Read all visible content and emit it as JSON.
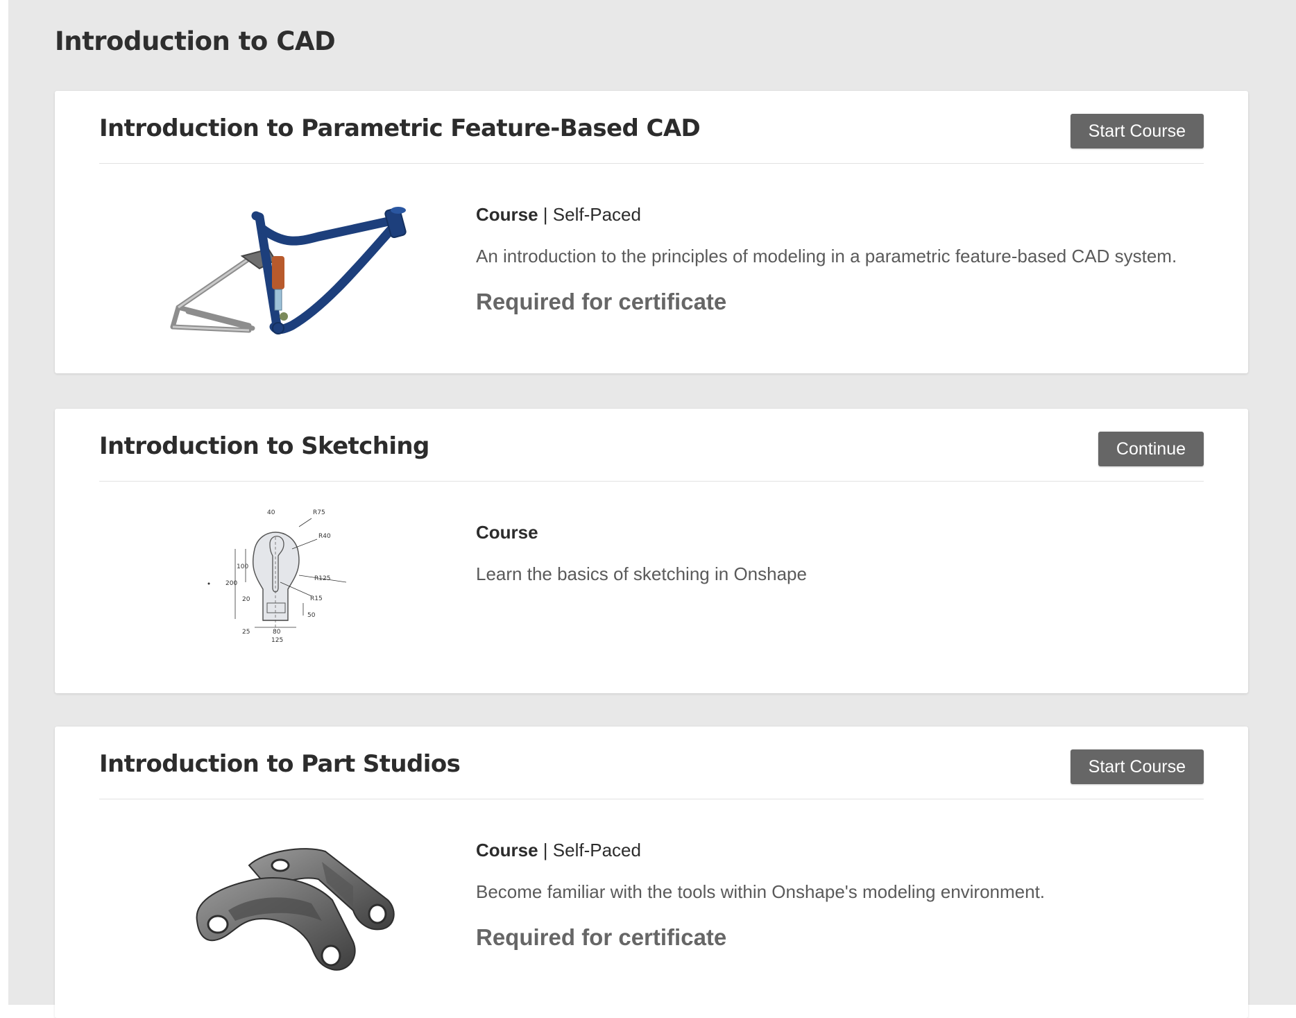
{
  "page": {
    "section_title": "Introduction to CAD"
  },
  "courses": [
    {
      "title": "Introduction to Parametric Feature-Based CAD",
      "button_label": "Start Course",
      "type": "Course",
      "separator": " | ",
      "pace": "Self-Paced",
      "description": "An introduction to the principles of modeling in a parametric feature-based CAD system.",
      "requirement": "Required for certificate",
      "image_icon": "bike-frame-icon"
    },
    {
      "title": "Introduction to Sketching",
      "button_label": "Continue",
      "type": "Course",
      "description": "Learn the basics of sketching in Onshape",
      "image_icon": "sketch-drawing-icon",
      "sketch_labels": [
        "40",
        "R75",
        "R40",
        "100",
        "200",
        "R125",
        "20",
        "R15",
        "50",
        "25",
        "80",
        "125"
      ]
    },
    {
      "title": "Introduction to Part Studios",
      "button_label": "Start Course",
      "type": "Course",
      "separator": " | ",
      "pace": "Self-Paced",
      "description": "Become familiar with the tools within Onshape's modeling environment.",
      "requirement": "Required for certificate",
      "image_icon": "bracket-part-icon"
    }
  ],
  "colors": {
    "page_background": "#e8e8e8",
    "card_background": "#ffffff",
    "button_background": "#666666",
    "frame_blue": "#1d3f7c",
    "shock_orange": "#b85a2c"
  }
}
